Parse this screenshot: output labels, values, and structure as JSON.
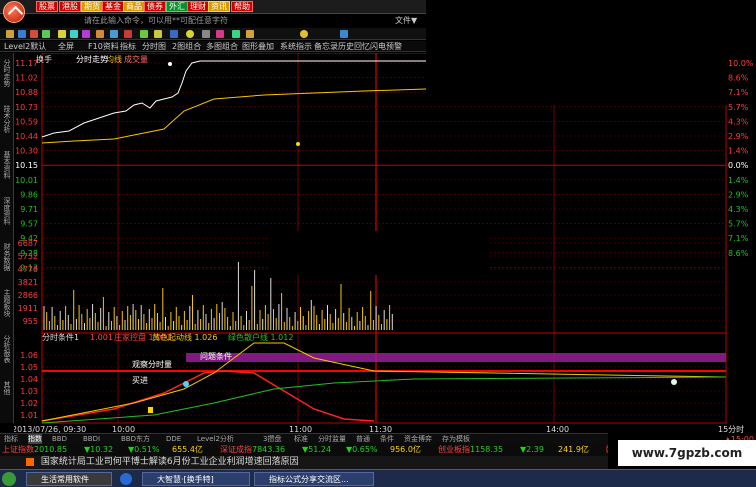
{
  "toolbar": {
    "buttons": [
      "股票",
      "港股",
      "期货",
      "基金",
      "商品",
      "债券",
      "外汇",
      "理财",
      "资讯",
      "帮助"
    ],
    "command_placeholder": "请在此输入命令，可以用**可配任意字符",
    "right_label": "文件▼"
  },
  "tabs": [
    "Level2默认",
    "全屏",
    "F10资料",
    "指标",
    "分时图",
    "2图组合",
    "多图组合",
    "图形叠加",
    "系统指示",
    "备忘录",
    "历史回忆",
    "闪电预警"
  ],
  "sidebar": [
    "分时走势",
    "技术分析",
    "基本资料",
    "深度资料",
    "财务数据",
    "主题板块",
    "分析报表",
    "其他"
  ],
  "price_chart": {
    "legend": [
      "换手",
      "分时走势",
      "均线",
      "成交量"
    ],
    "price_ticks": [
      "11.17",
      "11.02",
      "10.88",
      "10.73",
      "10.59",
      "10.44",
      "10.30",
      "10.15",
      "10.01",
      "9.86",
      "9.71",
      "9.57",
      "9.42",
      "9.28",
      "9.13"
    ],
    "pct_ticks": [
      "10.0%",
      "8.6%",
      "7.1%",
      "5.7%",
      "4.3%",
      "2.9%",
      "1.4%",
      "0.0%",
      "1.4%",
      "2.9%",
      "4.3%",
      "5.7%",
      "7.1%",
      "8.6%"
    ],
    "colors": {
      "up": "#ff3b3b",
      "down": "#22c022",
      "grid": "#7a0000",
      "price": "#ffffff",
      "avg": "#f5c700"
    }
  },
  "volume_chart": {
    "ticks": [
      "6687",
      "5732",
      "4776",
      "3821",
      "2866",
      "1911",
      "955"
    ]
  },
  "indicator": {
    "label": "分时条件1",
    "values": [
      "1.001",
      "庄家控盘 1.003",
      "黄色起动线 1.026",
      "绿色散户线 1.012"
    ],
    "ticks": [
      "1.06",
      "1.05",
      "1.04",
      "1.03",
      "1.02",
      "1.01"
    ],
    "annotations": [
      "观察分时量",
      "问题条件",
      "买进"
    ]
  },
  "time_axis": {
    "date_label": "2013/07/26, 09:30",
    "ticks": [
      "10:00",
      "11:00",
      "11:30",
      "14:00"
    ],
    "period_label": "15分时"
  },
  "bottom_tabs": [
    "指标",
    "指数",
    "BBD",
    "BBDI",
    "BBD东方",
    "DDE",
    "Level2分析",
    "3攒盘",
    "标准",
    "分时监量",
    "普通",
    "条件",
    "资金博弈",
    "存为模板"
  ],
  "ticker": [
    {
      "name": "上证指数",
      "value": "2010.85",
      "change": "▼10.32",
      "pct": "▼0.51%",
      "vol": "655.4亿"
    },
    {
      "name": "深证成指",
      "value": "7843.36",
      "change": "▼51.24",
      "pct": "▼0.65%",
      "vol": "956.0亿"
    },
    {
      "name": "创业板指",
      "value": "1158.35",
      "change": "▼2.39",
      "pct": "",
      "vol": "241.9亿"
    },
    {
      "name": "欧洲斯",
      "value": "",
      "change": "",
      "pct": "",
      "vol": ""
    }
  ],
  "news": "国家统计局工业司何平博士解读6月份工业企业利润增速回落原因",
  "taskbar": [
    "生活常用软件",
    "大智慧·[换手特]",
    "指标公式分享交流区..."
  ],
  "watermark": "www.7gpzb.com",
  "rightpanel_time": "▲15:00"
}
